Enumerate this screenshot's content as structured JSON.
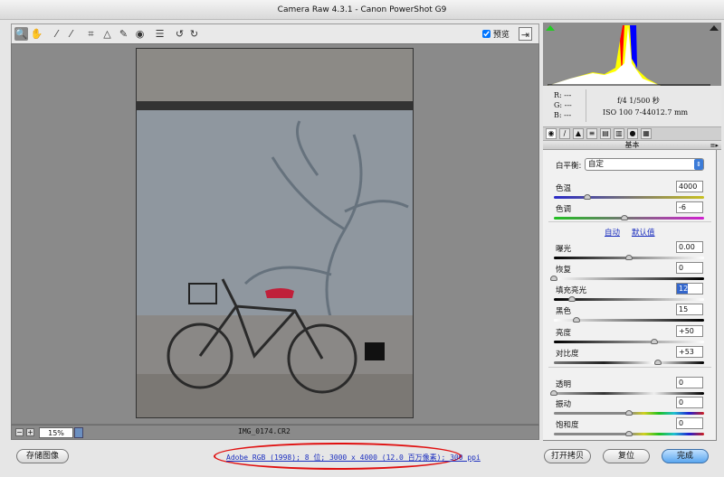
{
  "window": {
    "title": "Camera Raw 4.3.1 - Canon PowerShot G9"
  },
  "toolbar": {
    "tools": [
      {
        "name": "zoom-tool",
        "glyph": "🔍"
      },
      {
        "name": "hand-tool",
        "glyph": "✋"
      },
      {
        "name": "white-balance-tool",
        "glyph": "⁄"
      },
      {
        "name": "color-sampler-tool",
        "glyph": "⁄"
      },
      {
        "name": "crop-tool",
        "glyph": "⌗"
      },
      {
        "name": "straighten-tool",
        "glyph": "△"
      },
      {
        "name": "retouch-tool",
        "glyph": "✎"
      },
      {
        "name": "red-eye-tool",
        "glyph": "◉"
      },
      {
        "name": "preferences-tool",
        "glyph": "☰"
      },
      {
        "name": "rotate-ccw-tool",
        "glyph": "↺"
      },
      {
        "name": "rotate-cw-tool",
        "glyph": "↻"
      }
    ],
    "preview_label": "预览",
    "preview_checked": true
  },
  "preview": {
    "filename": "IMG_0174.CR2",
    "zoom": "15%"
  },
  "info": {
    "r": "R:  ---",
    "g": "G:  ---",
    "b": "B:  ---",
    "aperture_shutter": "f/4   1/500 秒",
    "iso_focal": "ISO 100   7-44012.7 mm"
  },
  "panel": {
    "title": "基本",
    "white_balance_label": "白平衡:",
    "white_balance_value": "自定",
    "auto_label": "自动",
    "default_label": "默认值",
    "sliders": [
      {
        "label": "色温",
        "value": "4000",
        "pos": 0.22,
        "track": "linear-gradient(90deg,#2a2ac8,#c8c020)"
      },
      {
        "label": "色调",
        "value": "-6",
        "pos": 0.47,
        "track": "linear-gradient(90deg,#20c020,#d020d0)"
      },
      {
        "label": "曝光",
        "value": "0.00",
        "pos": 0.5,
        "track": "linear-gradient(90deg,#000,#fff)"
      },
      {
        "label": "恢复",
        "value": "0",
        "pos": 0.0,
        "track": "linear-gradient(90deg,#fff,#000)"
      },
      {
        "label": "填充亮光",
        "value": "12",
        "pos": 0.12,
        "track": "linear-gradient(90deg,#000,#fff)"
      },
      {
        "label": "黑色",
        "value": "15",
        "pos": 0.15,
        "track": "linear-gradient(90deg,#fff,#000)"
      },
      {
        "label": "亮度",
        "value": "+50",
        "pos": 0.67,
        "track": "linear-gradient(90deg,#000,#fff)"
      },
      {
        "label": "对比度",
        "value": "+53",
        "pos": 0.69,
        "track": "linear-gradient(90deg,#777,#222,#fff,#000)"
      },
      {
        "label": "透明",
        "value": "0",
        "pos": 0.0,
        "track": "linear-gradient(90deg,#aaa,#333,#eee,#000)"
      },
      {
        "label": "振动",
        "value": "0",
        "pos": 0.5,
        "track": "linear-gradient(90deg,#888,#888 50%,#d0d020,#20c020,#20c0d0,#2020d0,#d02020)"
      },
      {
        "label": "饱和度",
        "value": "0",
        "pos": 0.5,
        "track": "linear-gradient(90deg,#888,#888 50%,#d0d020,#20c020,#20c0d0,#2020d0,#d02020)"
      }
    ]
  },
  "footer": {
    "save_label": "存储图像",
    "file_info": "Adobe RGB (1998); 8 位; 3000 x 4000 (12.0 百万像素); 300 ppi",
    "open_copy_label": "打开拷贝",
    "reset_label": "复位",
    "done_label": "完成"
  },
  "colors": {
    "accent": "#5aa6ef",
    "link": "#1c2fbf",
    "annotation": "#e01010"
  }
}
